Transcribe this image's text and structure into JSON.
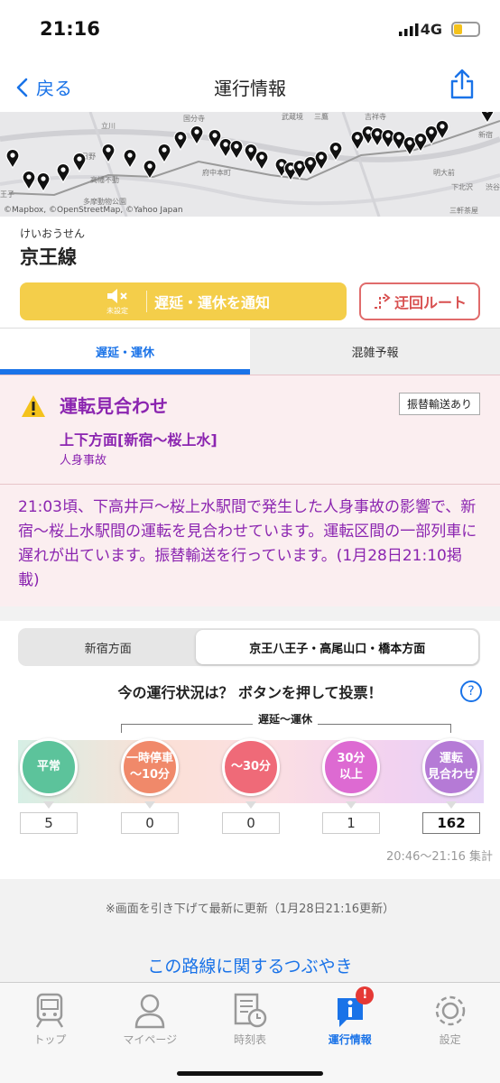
{
  "status_bar": {
    "time": "21:16",
    "network": "4G"
  },
  "nav": {
    "back_label": "戻る",
    "title": "運行情報"
  },
  "map": {
    "credit": "©Mapbox, ©OpenStreetMap, ©Yahoo Japan",
    "labels": [
      "立川",
      "国分寺",
      "武蔵境",
      "三鷹",
      "吉祥寺",
      "新宿",
      "日野",
      "高幡不動",
      "多摩動物公園",
      "府中本町",
      "明大前",
      "下北沢",
      "渋谷",
      "三軒茶屋",
      "王子"
    ]
  },
  "line": {
    "kana": "けいおうせん",
    "name": "京王線"
  },
  "buttons": {
    "mute_label": "未設定",
    "notify_label": "遅延・運休を通知",
    "detour_label": "迂回ルート"
  },
  "tabs": [
    {
      "label": "遅延・運休",
      "active": true
    },
    {
      "label": "混雑予報",
      "active": false
    }
  ],
  "alert": {
    "status": "運転見合わせ",
    "badge": "振替輸送あり",
    "direction": "上下方面[新宿〜桜上水]",
    "cause": "人身事故",
    "body": "21:03頃、下高井戸〜桜上水駅間で発生した人身事故の影響で、新宿〜桜上水駅間の運転を見合わせています。運転区間の一部列車に遅れが出ています。振替輸送を行っています。(1月28日21:10掲載)"
  },
  "vote": {
    "segments": [
      "新宿方面",
      "京王八王子・高尾山口・橋本方面"
    ],
    "question": "今の運行状況は？ ボタンを押して投票！",
    "help": "?",
    "delay_label": "遅延〜運休",
    "options": [
      {
        "label1": "平常",
        "label2": "",
        "count": "5",
        "color": "#5cc39b"
      },
      {
        "label1": "一時停車",
        "label2": "〜10分",
        "count": "0",
        "color": "#f0896a"
      },
      {
        "label1": "〜30分",
        "label2": "",
        "count": "0",
        "color": "#ef6a78"
      },
      {
        "label1": "30分",
        "label2": "以上",
        "count": "1",
        "color": "#dd6ad2"
      },
      {
        "label1": "運転",
        "label2": "見合わせ",
        "count": "162",
        "color": "#b57ad6"
      }
    ],
    "period": "20:46〜21:16 集計"
  },
  "refresh_note": "※画面を引き下げて最新に更新（1月28日21:16更新）",
  "tweets_link": "この路線に関するつぶやき",
  "tabbar": [
    {
      "label": "トップ",
      "icon": "train-icon"
    },
    {
      "label": "マイページ",
      "icon": "person-icon"
    },
    {
      "label": "時刻表",
      "icon": "timetable-icon"
    },
    {
      "label": "運行情報",
      "icon": "info-icon",
      "badge": "!"
    },
    {
      "label": "設定",
      "icon": "gear-icon"
    }
  ]
}
